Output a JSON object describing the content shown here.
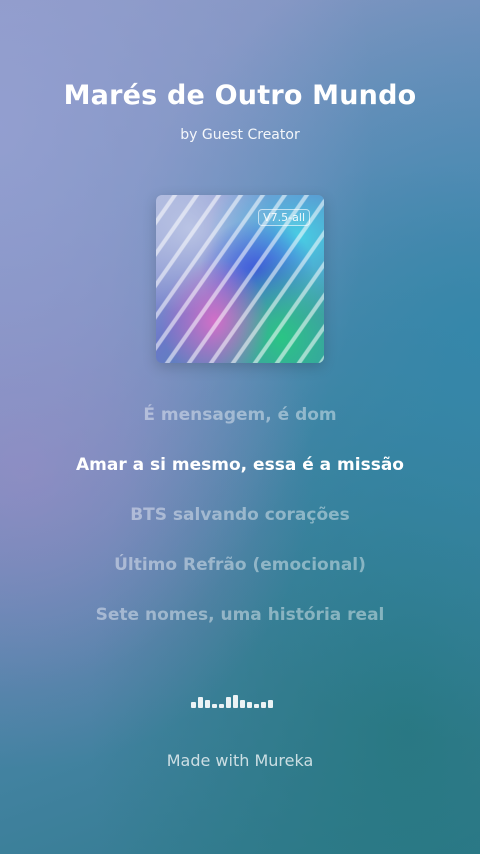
{
  "song": {
    "title": "Marés de Outro Mundo",
    "artist_line": "by Guest Creator"
  },
  "cover": {
    "badge": "V7.5-all"
  },
  "lyrics": [
    {
      "text": "É mensagem, é dom",
      "active": false
    },
    {
      "text": "Amar a si mesmo, essa é a missão",
      "active": true
    },
    {
      "text": "BTS salvando corações ",
      "active": false
    },
    {
      "text": "Último Refrão (emocional)",
      "active": false
    },
    {
      "text": "Sete nomes, uma história real",
      "active": false
    }
  ],
  "visualizer": {
    "levels": [
      0.45,
      0.75,
      0.6,
      0.3,
      0.3,
      0.75,
      0.9,
      0.6,
      0.45,
      0.3,
      0.45,
      0.55
    ]
  },
  "footer": {
    "text": "Made with Mureka"
  },
  "colors": {
    "background_top": "#8a98c4",
    "background_bottom": "#2f7a8c",
    "active_lyric": "#ffffff"
  }
}
